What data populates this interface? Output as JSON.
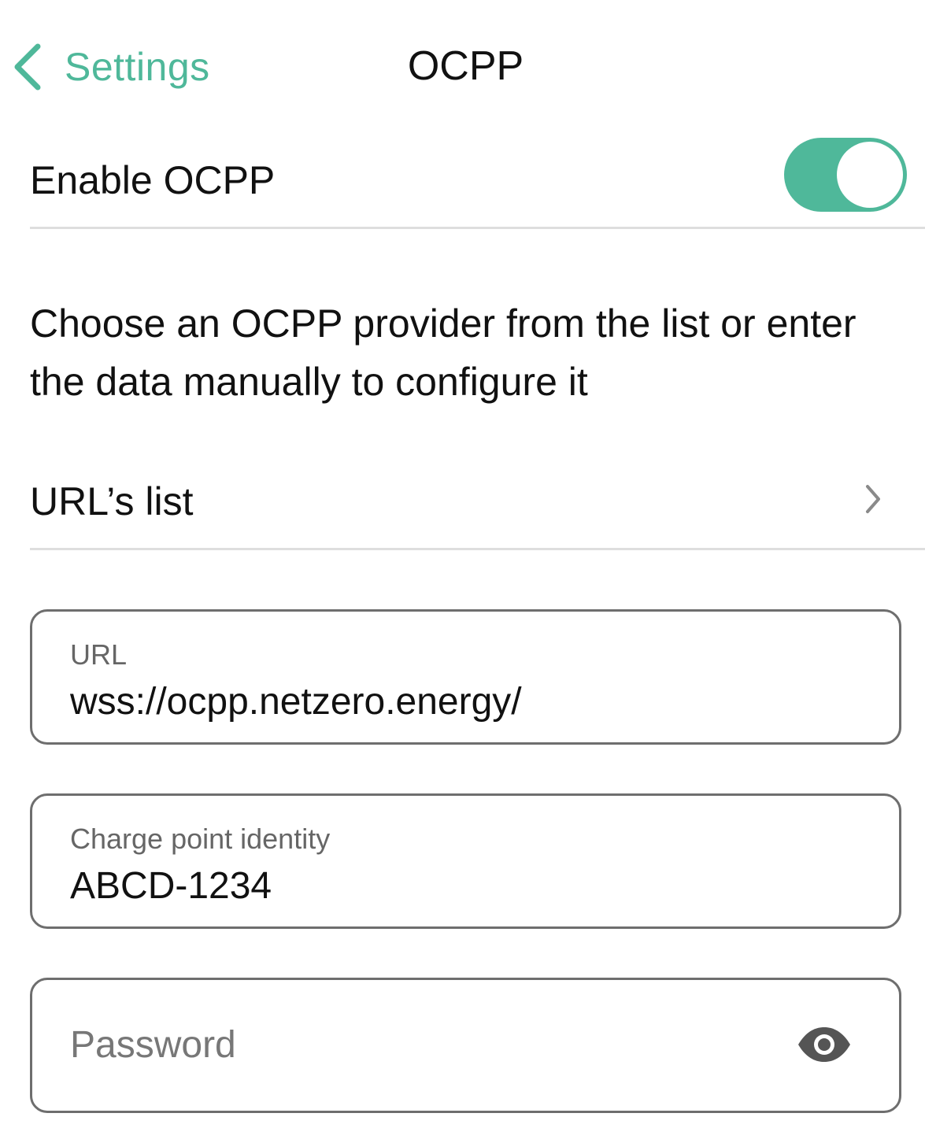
{
  "nav": {
    "back_label": "Settings",
    "title": "OCPP",
    "back_icon": "chevron-left-icon"
  },
  "enable_row": {
    "label": "Enable OCPP",
    "toggle_on": true
  },
  "description": "Choose an OCPP provider from the list or enter the data manually to configure it",
  "url_list_row": {
    "label": "URL’s list",
    "icon": "chevron-right-icon"
  },
  "fields": {
    "url": {
      "label": "URL",
      "value": "wss://ocpp.netzero.energy/"
    },
    "charge_point": {
      "label": "Charge point identity",
      "value": "ABCD-1234"
    },
    "password": {
      "placeholder": "Password",
      "value": "",
      "icon": "eye-icon"
    }
  },
  "colors": {
    "accent": "#4fb89a",
    "border": "#6e6e6e",
    "divider": "#dedede"
  }
}
